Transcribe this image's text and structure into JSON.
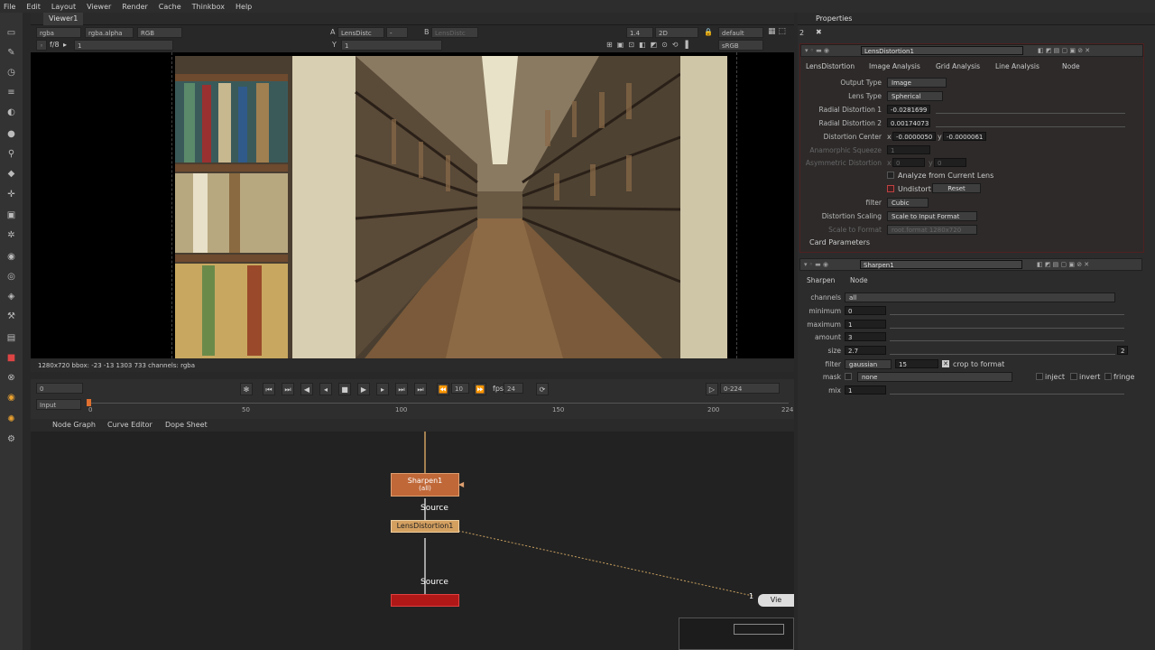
{
  "menu": [
    "File",
    "Edit",
    "Layout",
    "Viewer",
    "Render",
    "Cache",
    "Thinkbox",
    "Help"
  ],
  "viewer": {
    "tab": "Viewer1",
    "channels": "rgba",
    "alpha": "rgba.alpha",
    "color": "RGB",
    "input_a_label": "A",
    "input_a": "LensDistc",
    "input_b_label": "B",
    "input_b": "LensDistc",
    "gain": "1.4",
    "view_mode": "2D",
    "lut": "default",
    "display": "sRGB",
    "fstop": "f/8",
    "frame": "1",
    "y_label": "Y",
    "y_value": "1",
    "status": "1280x720 bbox: -23 -13 1303 733 channels: rgba"
  },
  "timeline": {
    "frame": "0",
    "input": "Input",
    "fps_label": "fps",
    "fps": "24",
    "step": "10",
    "range": "0-224",
    "ticks": [
      "0",
      "50",
      "100",
      "150",
      "200",
      "224"
    ]
  },
  "nodegraph": {
    "tabs": [
      "Node Graph",
      "Curve Editor",
      "Dope Sheet"
    ],
    "sharpen_node": "Sharpen1",
    "sharpen_sub": "(all)",
    "source_label": "Source",
    "lens_node": "LensDistortion1",
    "source_label2": "Source",
    "viewer_node": "Vie",
    "pipe_number": "1"
  },
  "properties": {
    "title": "Properties",
    "count": "2",
    "lens": {
      "name": "LensDistortion1",
      "tabs": [
        "LensDistortion",
        "Image Analysis",
        "Grid Analysis",
        "Line Analysis",
        "Node"
      ],
      "output_type_label": "Output Type",
      "output_type": "Image",
      "lens_type_label": "Lens Type",
      "lens_type": "Spherical",
      "radial1_label": "Radial Distortion 1",
      "radial1": "-0.0281699",
      "radial2_label": "Radial Distortion 2",
      "radial2": "0.00174073",
      "center_label": "Distortion Center",
      "center_x_label": "x",
      "center_x": "-0.0000050",
      "center_y_label": "y",
      "center_y": "-0.0000061",
      "anamorphic_label": "Anamorphic Squeeze",
      "anamorphic": "1",
      "asym_label": "Asymmetric Distortion",
      "asym_x_label": "x",
      "asym_x": "0",
      "asym_y_label": "y",
      "asym_y": "0",
      "analyze_label": "Analyze from Current Lens",
      "undistort_label": "Undistort",
      "reset_label": "Reset",
      "filter_label": "filter",
      "filter": "Cubic",
      "scaling_label": "Distortion Scaling",
      "scaling": "Scale to Input Format",
      "scale_format_label": "Scale to Format",
      "scale_format": "root.format 1280x720",
      "card_params": "Card Parameters"
    },
    "sharpen": {
      "name": "Sharpen1",
      "tabs": [
        "Sharpen",
        "Node"
      ],
      "channels_label": "channels",
      "channels": "all",
      "minimum_label": "minimum",
      "minimum": "0",
      "maximum_label": "maximum",
      "maximum": "1",
      "amount_label": "amount",
      "amount": "3",
      "size_label": "size",
      "size": "2.7",
      "size_right": "2",
      "filter_label": "filter",
      "filter": "gaussian",
      "filter_quality": "15",
      "crop_label": "crop to format",
      "mask_label": "mask",
      "mask": "none",
      "inject_label": "inject",
      "invert_label": "invert",
      "fringe_label": "fringe",
      "mix_label": "mix",
      "mix": "1"
    }
  }
}
